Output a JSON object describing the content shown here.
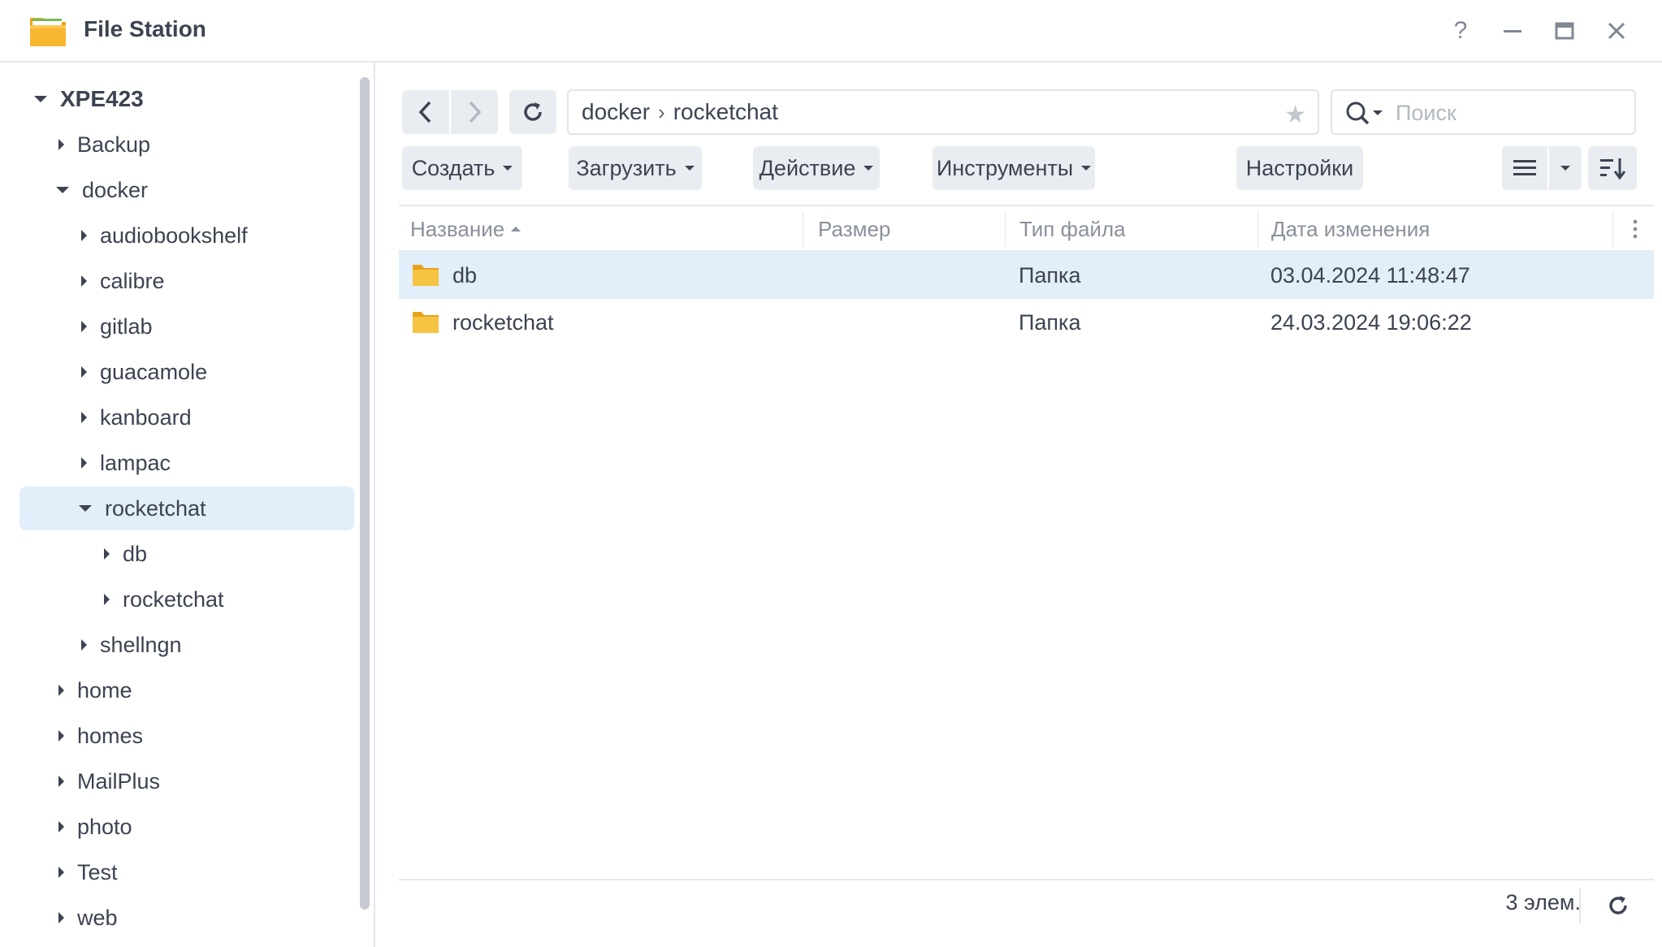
{
  "window": {
    "title": "File Station",
    "help_glyph": "?",
    "minimize_glyph": "—",
    "maximize_glyph": "🗖",
    "close_glyph": "✕"
  },
  "sidebar": {
    "root": "XPE423",
    "items": [
      {
        "label": "Backup",
        "expanded": false
      },
      {
        "label": "docker",
        "expanded": true
      },
      {
        "label": "audiobookshelf",
        "expanded": false
      },
      {
        "label": "calibre",
        "expanded": false
      },
      {
        "label": "gitlab",
        "expanded": false
      },
      {
        "label": "guacamole",
        "expanded": false
      },
      {
        "label": "kanboard",
        "expanded": false
      },
      {
        "label": "lampac",
        "expanded": false
      },
      {
        "label": "rocketchat",
        "expanded": true,
        "selected": true
      },
      {
        "label": "db",
        "expanded": false
      },
      {
        "label": "rocketchat",
        "expanded": false
      },
      {
        "label": "shellngn",
        "expanded": false
      },
      {
        "label": "home",
        "expanded": false
      },
      {
        "label": "homes",
        "expanded": false
      },
      {
        "label": "MailPlus",
        "expanded": false
      },
      {
        "label": "photo",
        "expanded": false
      },
      {
        "label": "Test",
        "expanded": false
      },
      {
        "label": "web",
        "expanded": false
      }
    ]
  },
  "toolbar": {
    "path": [
      "docker",
      "rocketchat"
    ],
    "path_separator": "›",
    "search_placeholder": "Поиск",
    "create_label": "Создать",
    "upload_label": "Загрузить",
    "action_label": "Действие",
    "tools_label": "Инструменты",
    "settings_label": "Настройки"
  },
  "table": {
    "columns": {
      "name": "Название",
      "size": "Размер",
      "type": "Тип файла",
      "modified": "Дата изменения"
    },
    "rows": [
      {
        "name": "db",
        "size": "",
        "type": "Папка",
        "modified": "03.04.2024 11:48:47",
        "selected": true
      },
      {
        "name": "rocketchat",
        "size": "",
        "type": "Папка",
        "modified": "24.03.2024 19:06:22",
        "selected": false
      }
    ]
  },
  "footer": {
    "count": "3 элем."
  },
  "colors": {
    "accent_selection": "#e3eefb",
    "folder": "#f6c443"
  }
}
